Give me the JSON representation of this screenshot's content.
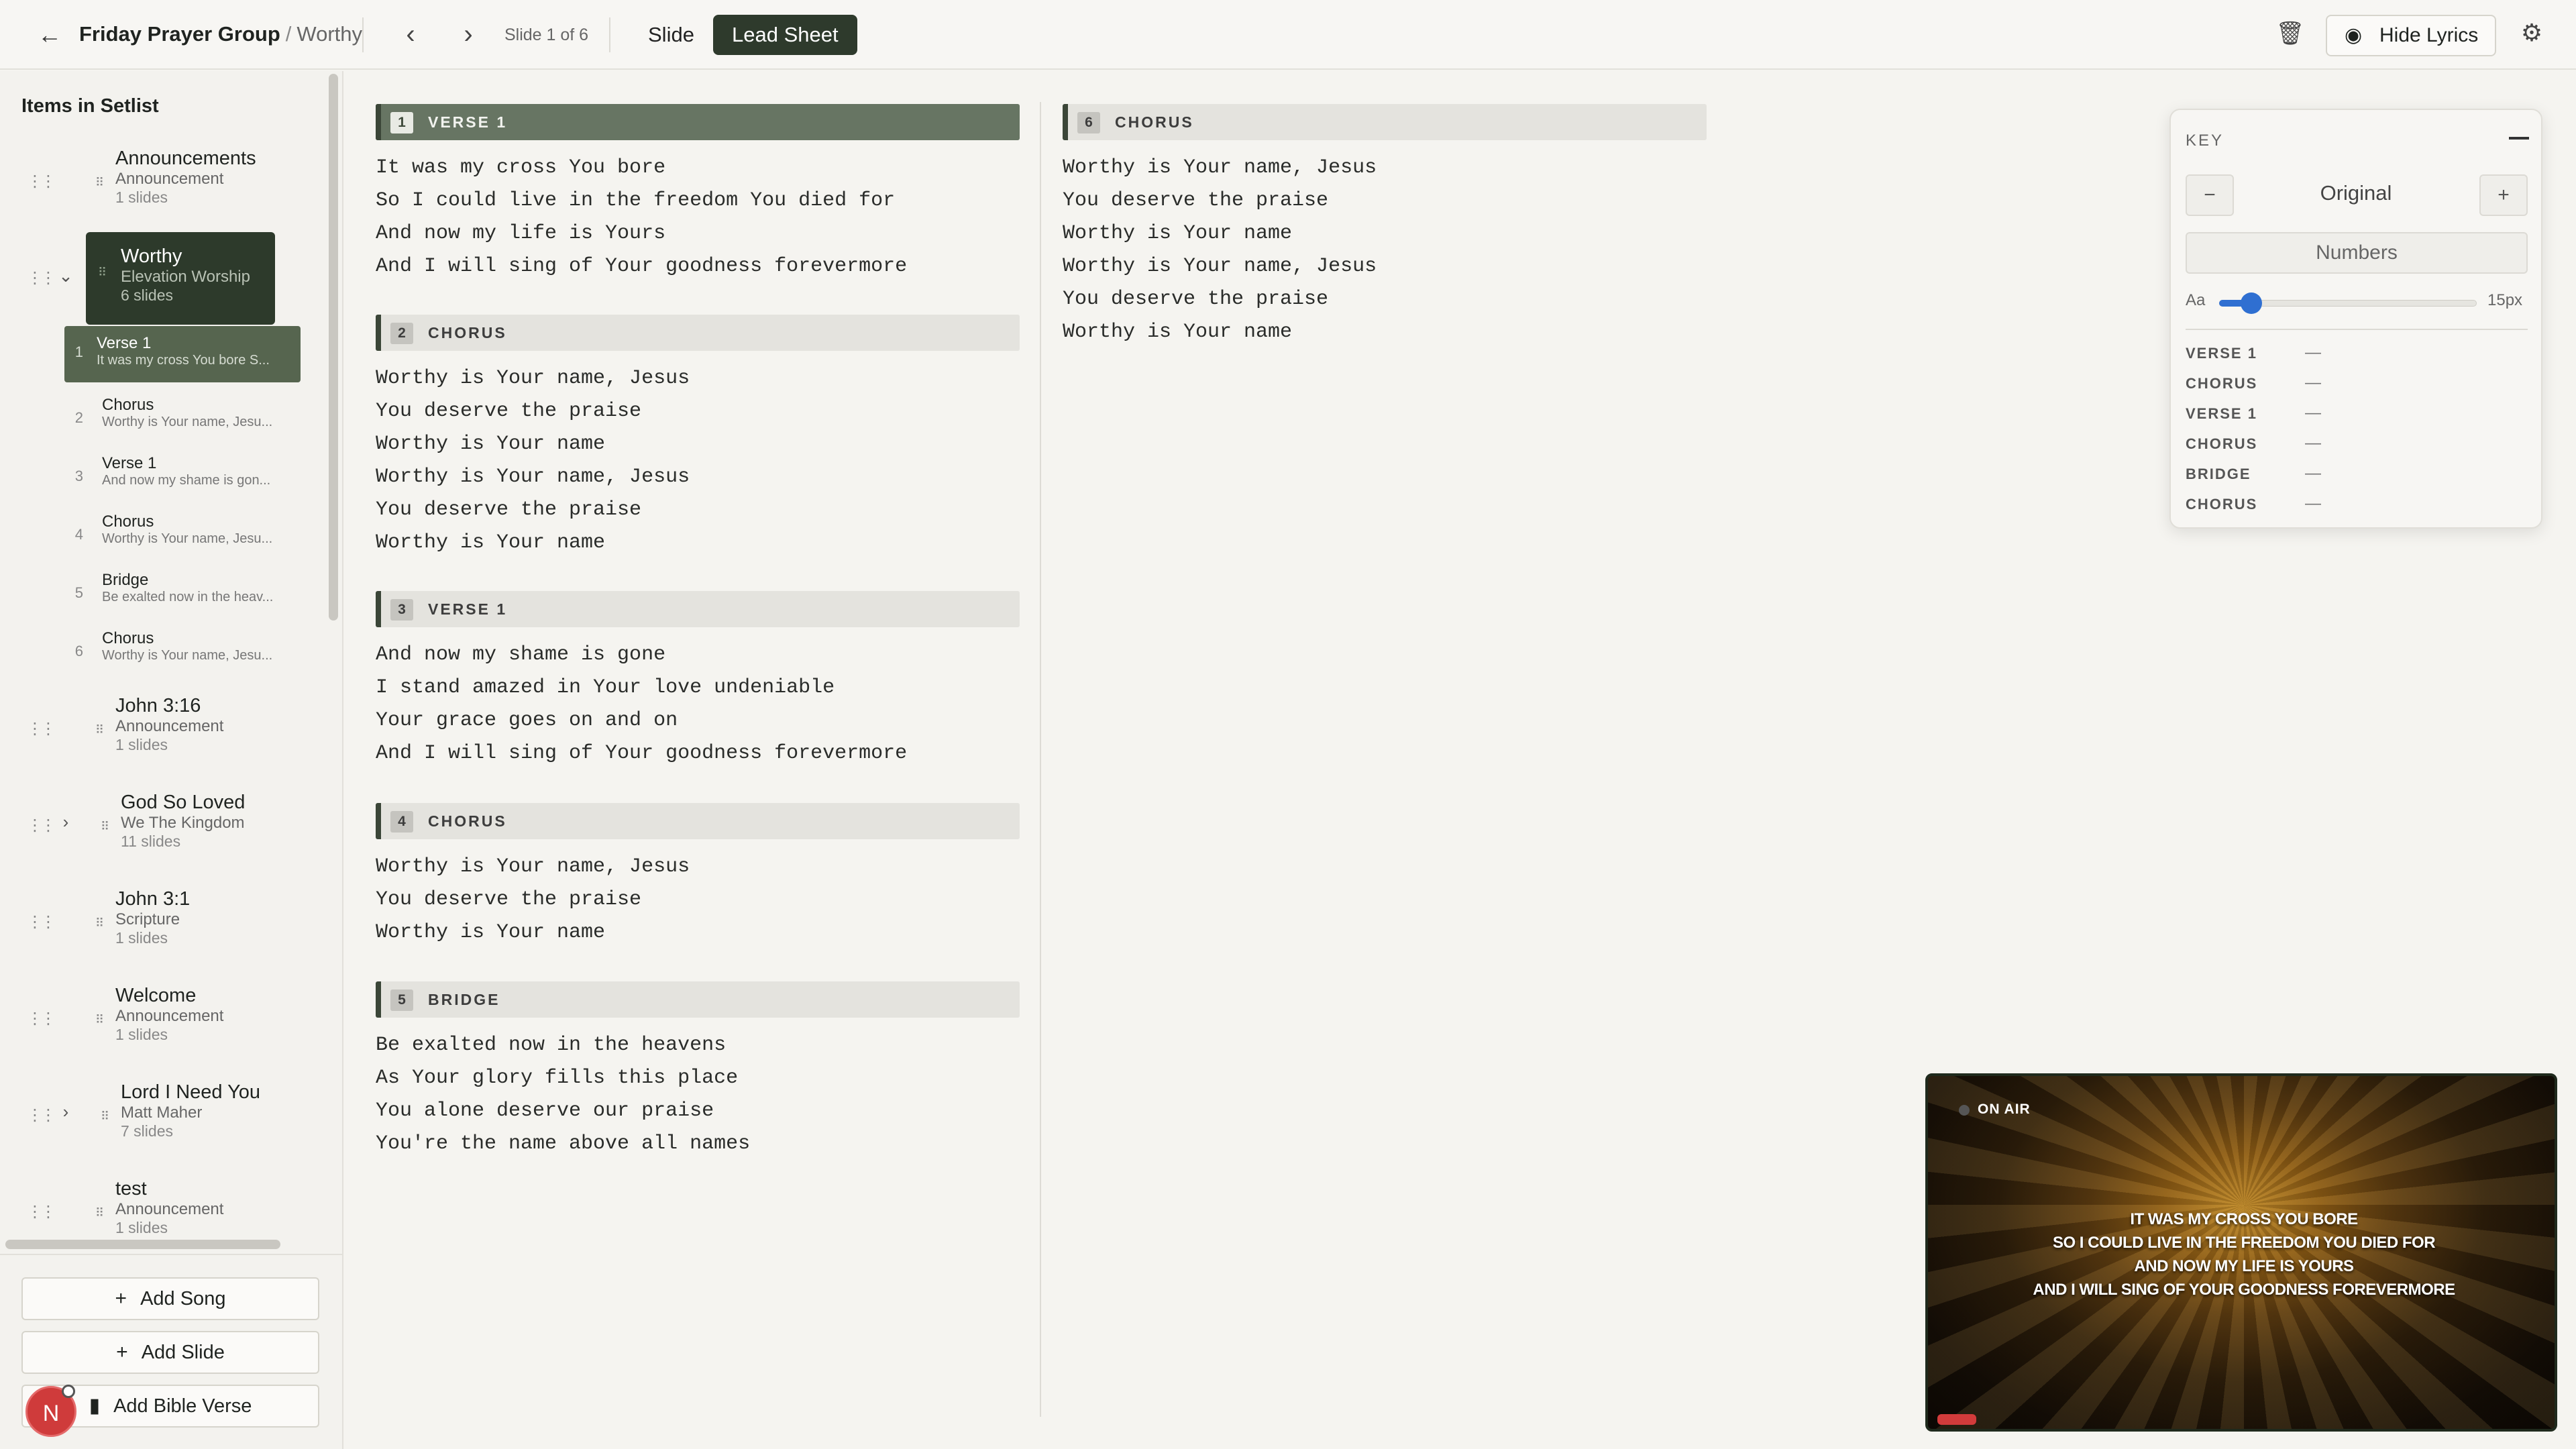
{
  "topbar": {
    "back_icon": "arrow-left-icon",
    "group": "Friday Prayer Group",
    "separator": "/",
    "song": "Worthy",
    "slide_counter": "Slide 1 of 6",
    "mode_slide": "Slide",
    "mode_lead_sheet": "Lead Sheet",
    "active_mode": "Lead Sheet",
    "hide_lyrics": "Hide Lyrics"
  },
  "sidebar": {
    "title": "Items in Setlist",
    "items": [
      {
        "title": "Announcements",
        "sub": "Announcement",
        "count": "1 slides"
      },
      {
        "title": "Worthy",
        "sub": "Elevation Worship",
        "count": "6 slides"
      },
      {
        "title": "John 3:16",
        "sub": "Announcement",
        "count": "1 slides"
      },
      {
        "title": "God So Loved",
        "sub": "We The Kingdom",
        "count": "11 slides"
      },
      {
        "title": "John 3:1",
        "sub": "Scripture",
        "count": "1 slides"
      },
      {
        "title": "Welcome",
        "sub": "Announcement",
        "count": "1 slides"
      },
      {
        "title": "Lord I Need You",
        "sub": "Matt Maher",
        "count": "7 slides"
      },
      {
        "title": "test",
        "sub": "Announcement",
        "count": "1 slides"
      }
    ],
    "subslides": [
      {
        "num": "1",
        "name": "Verse 1",
        "line": "It was my cross You bore S..."
      },
      {
        "num": "2",
        "name": "Chorus",
        "line": "Worthy is Your name, Jesu..."
      },
      {
        "num": "3",
        "name": "Verse 1",
        "line": "And now my shame is gon..."
      },
      {
        "num": "4",
        "name": "Chorus",
        "line": "Worthy is Your name, Jesu..."
      },
      {
        "num": "5",
        "name": "Bridge",
        "line": "Be exalted now in the heav..."
      },
      {
        "num": "6",
        "name": "Chorus",
        "line": "Worthy is Your name, Jesu..."
      }
    ],
    "buttons": {
      "add_song": "Add Song",
      "add_slide": "Add Slide",
      "add_bible_verse": "Add Bible Verse"
    },
    "avatar_initial": "N"
  },
  "sheet": {
    "sections": [
      {
        "num": "1",
        "label": "VERSE 1",
        "lines": [
          "It was my cross You bore",
          "So I could live in the freedom You died for",
          "And now my life is Yours",
          "And I will sing of Your goodness forevermore"
        ]
      },
      {
        "num": "2",
        "label": "CHORUS",
        "lines": [
          "Worthy is Your name, Jesus",
          "You deserve the praise",
          "Worthy is Your name",
          "Worthy is Your name, Jesus",
          "You deserve the praise",
          "Worthy is Your name"
        ]
      },
      {
        "num": "3",
        "label": "VERSE 1",
        "lines": [
          "And now my shame is gone",
          "I stand amazed in Your love undeniable",
          "Your grace goes on and on",
          "And I will sing of Your goodness forevermore"
        ]
      },
      {
        "num": "4",
        "label": "CHORUS",
        "lines": [
          "Worthy is Your name, Jesus",
          "You deserve the praise",
          "Worthy is Your name"
        ]
      },
      {
        "num": "5",
        "label": "BRIDGE",
        "lines": [
          "Be exalted now in the heavens",
          "As Your glory fills this place",
          "You alone deserve our praise",
          "You're the name above all names"
        ]
      },
      {
        "num": "6",
        "label": "CHORUS",
        "lines": [
          "Worthy is Your name, Jesus",
          "You deserve the praise",
          "Worthy is Your name",
          "Worthy is Your name, Jesus",
          "You deserve the praise",
          "Worthy is Your name"
        ]
      }
    ]
  },
  "key_panel": {
    "title": "KEY",
    "minus": "−",
    "plus": "+",
    "key_value": "Original",
    "numbers": "Numbers",
    "font_label": "Aa",
    "font_size": "15px",
    "font_size_fraction": 0.1,
    "rows": [
      {
        "label": "VERSE 1",
        "value": "—"
      },
      {
        "label": "CHORUS",
        "value": "—"
      },
      {
        "label": "VERSE 1",
        "value": "—"
      },
      {
        "label": "CHORUS",
        "value": "—"
      },
      {
        "label": "BRIDGE",
        "value": "—"
      },
      {
        "label": "CHORUS",
        "value": "—"
      }
    ]
  },
  "preview": {
    "status": "ON AIR",
    "lines": [
      "IT WAS MY CROSS YOU BORE",
      "SO I COULD LIVE IN THE FREEDOM YOU DIED FOR",
      "AND NOW MY LIFE IS YOURS",
      "AND I WILL SING OF YOUR GOODNESS FOREVERMORE"
    ]
  },
  "colors": {
    "accent_dark": "#2e3a2c",
    "accent_sub": "#56654f",
    "slider": "#2f6fd1",
    "avatar": "#cf3b3b"
  }
}
